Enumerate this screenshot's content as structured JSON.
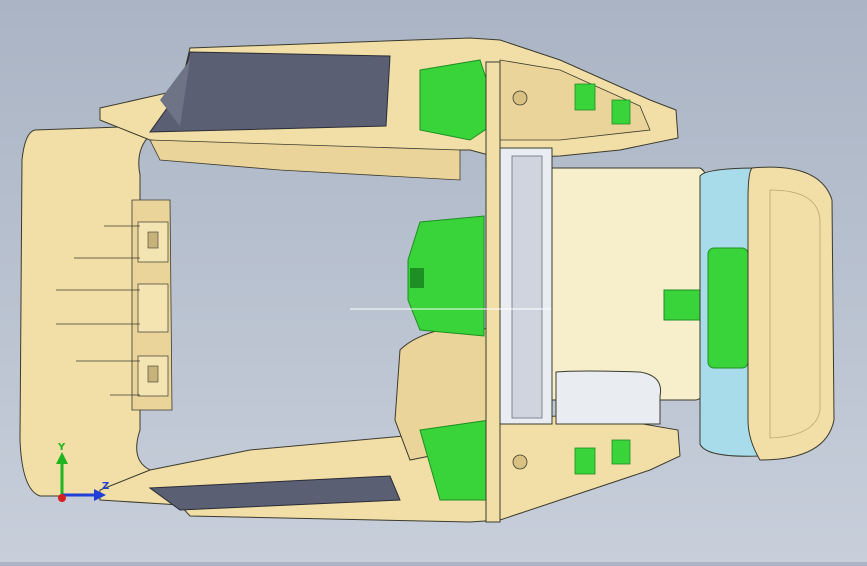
{
  "viewport": {
    "background_top": "#aab4c4",
    "background_bottom": "#c8cfdb"
  },
  "model": {
    "colors": {
      "shell": "#f2dfa7",
      "shell_shadow": "#d8c182",
      "edge": "#3b3b2e",
      "green_part": "#39d33a",
      "green_dark": "#1e8f22",
      "dark_panel": "#5a5f73",
      "blue_part": "#a9dcea",
      "white_part": "#e9ecf1"
    }
  },
  "triad": {
    "y_label": "Y",
    "x_label": "Z",
    "y_color": "#1fb51f",
    "x_color": "#1f3fd6",
    "z_color": "#d61f1f"
  }
}
